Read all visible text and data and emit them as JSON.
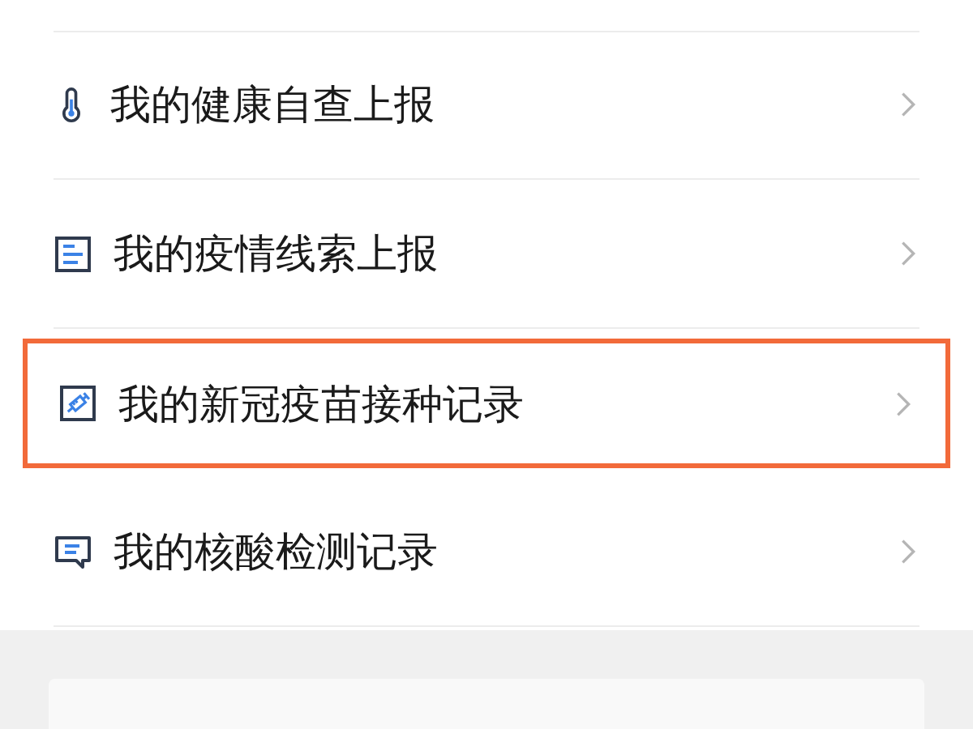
{
  "menu": {
    "items": [
      {
        "kind": "thermometer",
        "label": "我的健康自查上报",
        "highlighted": false
      },
      {
        "kind": "document",
        "label": "我的疫情线索上报",
        "highlighted": false
      },
      {
        "kind": "vaccine",
        "label": "我的新冠疫苗接种记录",
        "highlighted": true
      },
      {
        "kind": "message",
        "label": "我的核酸检测记录",
        "highlighted": false
      }
    ]
  }
}
